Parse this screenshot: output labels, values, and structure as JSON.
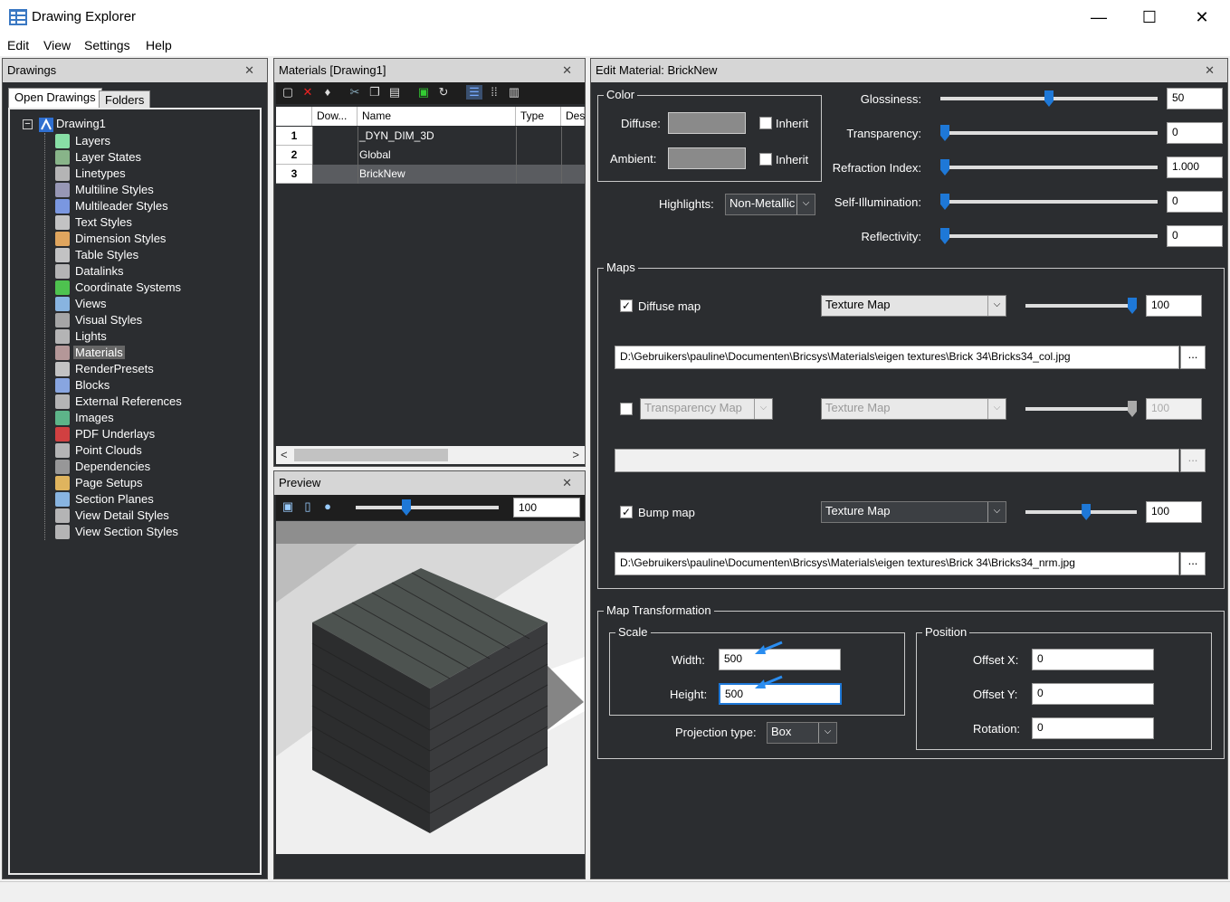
{
  "window": {
    "title": "Drawing Explorer",
    "minimize": "—",
    "maximize": "☐",
    "close": "✕"
  },
  "menu": [
    "Edit",
    "View",
    "Settings",
    "Help"
  ],
  "drawings_panel": {
    "title": "Drawings",
    "tabs": [
      "Open Drawings",
      "Folders"
    ],
    "tree_root": "Drawing1",
    "items": [
      {
        "label": "Layers",
        "icon": "layers-icon"
      },
      {
        "label": "Layer States",
        "icon": "layer-states-icon"
      },
      {
        "label": "Linetypes",
        "icon": "linetypes-icon"
      },
      {
        "label": "Multiline Styles",
        "icon": "multiline-icon"
      },
      {
        "label": "Multileader Styles",
        "icon": "multileader-icon"
      },
      {
        "label": "Text Styles",
        "icon": "text-style-icon"
      },
      {
        "label": "Dimension Styles",
        "icon": "dimension-icon"
      },
      {
        "label": "Table Styles",
        "icon": "table-icon"
      },
      {
        "label": "Datalinks",
        "icon": "datalink-icon"
      },
      {
        "label": "Coordinate Systems",
        "icon": "coordinate-icon"
      },
      {
        "label": "Views",
        "icon": "eye-icon"
      },
      {
        "label": "Visual Styles",
        "icon": "visual-style-icon"
      },
      {
        "label": "Lights",
        "icon": "light-icon"
      },
      {
        "label": "Materials",
        "icon": "material-icon"
      },
      {
        "label": "RenderPresets",
        "icon": "render-icon"
      },
      {
        "label": "Blocks",
        "icon": "block-icon"
      },
      {
        "label": "External References",
        "icon": "xref-icon"
      },
      {
        "label": "Images",
        "icon": "image-icon"
      },
      {
        "label": "PDF Underlays",
        "icon": "pdf-icon"
      },
      {
        "label": "Point Clouds",
        "icon": "cloud-icon"
      },
      {
        "label": "Dependencies",
        "icon": "dependency-icon"
      },
      {
        "label": "Page Setups",
        "icon": "page-setup-icon"
      },
      {
        "label": "Section Planes",
        "icon": "section-plane-icon"
      },
      {
        "label": "View Detail Styles",
        "icon": "detail-style-icon"
      },
      {
        "label": "View Section Styles",
        "icon": "section-style-icon"
      }
    ],
    "selected": "Materials"
  },
  "materials_panel": {
    "title": "Materials [Drawing1]",
    "columns": [
      "Dow...",
      "Name",
      "Type",
      "Des"
    ],
    "rows": [
      {
        "num": "1",
        "name": "_DYN_DIM_3D"
      },
      {
        "num": "2",
        "name": "Global"
      },
      {
        "num": "3",
        "name": "BrickNew"
      }
    ],
    "scroll_left": "<",
    "scroll_right": ">"
  },
  "preview_panel": {
    "title": "Preview",
    "zoom_value": "100"
  },
  "edit_panel": {
    "title": "Edit Material: BrickNew",
    "color_group": "Color",
    "diffuse_label": "Diffuse:",
    "ambient_label": "Ambient:",
    "inherit_label": "Inherit",
    "highlights_label": "Highlights:",
    "highlights_value": "Non-Metallic",
    "properties": [
      {
        "label": "Glossiness:",
        "value": "50",
        "level": 0.5
      },
      {
        "label": "Transparency:",
        "value": "0",
        "level": 0
      },
      {
        "label": "Refraction Index:",
        "value": "1.000",
        "level": 0
      },
      {
        "label": "Self-Illumination:",
        "value": "0",
        "level": 0
      },
      {
        "label": "Reflectivity:",
        "value": "0",
        "level": 0
      }
    ],
    "maps_group": "Maps",
    "diffuse_map": {
      "label": "Diffuse map",
      "type": "Texture Map",
      "value": "100",
      "level": 1.0,
      "path": "D:\\Gebruikers\\pauline\\Documenten\\Bricsys\\Materials\\eigen textures\\Brick 34\\Bricks34_col.jpg"
    },
    "transparency_map": {
      "label": "Transparency Map",
      "type": "Texture Map",
      "value": "100",
      "level": 1.0,
      "path": ""
    },
    "bump_map": {
      "label": "Bump map",
      "type": "Texture Map",
      "value": "100",
      "level": 0.55,
      "path": "D:\\Gebruikers\\pauline\\Documenten\\Bricsys\\Materials\\eigen textures\\Brick 34\\Bricks34_nrm.jpg"
    },
    "browse_label": "...",
    "map_transform_group": "Map Transformation",
    "scale_group": "Scale",
    "width_label": "Width:",
    "width_value": "500",
    "height_label": "Height:",
    "height_value": "500",
    "projection_label": "Projection type:",
    "projection_value": "Box",
    "position_group": "Position",
    "offset_x_label": "Offset X:",
    "offset_x_value": "0",
    "offset_y_label": "Offset Y:",
    "offset_y_value": "0",
    "rotation_label": "Rotation:",
    "rotation_value": "0"
  },
  "colors": {
    "panel_bg": "#2b2d30",
    "accent": "#1e78d7",
    "swatch": "#8a8a8a"
  }
}
